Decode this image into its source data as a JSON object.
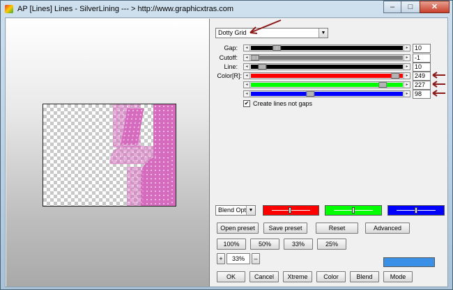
{
  "window": {
    "title": "AP [Lines]  Lines - SilverLining    --- > http://www.graphicxtras.com",
    "minimize": "–",
    "maximize": "□",
    "close": "✕"
  },
  "preset_combo": {
    "value": "Dotty Grid"
  },
  "params": [
    {
      "label": "Gap:",
      "value": "10",
      "fill_fraction": 0.15,
      "color": "#000000"
    },
    {
      "label": "Cutoff:",
      "value": "-1",
      "fill_fraction": 0.0,
      "color": "#7a7a7a"
    },
    {
      "label": "Line:",
      "value": "10",
      "fill_fraction": 0.05,
      "color": "#000000"
    }
  ],
  "color_label": "Color[R]:",
  "color_channels": [
    {
      "name": "red",
      "value": "249",
      "fraction": 0.976,
      "color": "#ff0000"
    },
    {
      "name": "green",
      "value": "227",
      "fraction": 0.89,
      "color": "#00ff00"
    },
    {
      "name": "blue",
      "value": "98",
      "fraction": 0.384,
      "color": "#0000ff"
    }
  ],
  "checkbox": {
    "label": "Create lines not gaps",
    "checked": true,
    "mark": "✔"
  },
  "blend_combo": {
    "value": "Blend Optio"
  },
  "swatches": [
    "#ff0000",
    "#00ff00",
    "#0000ff"
  ],
  "buttons": {
    "open_preset": "Open preset",
    "save_preset": "Save preset",
    "reset": "Reset",
    "advanced": "Advanced",
    "zoom100": "100%",
    "zoom50": "50%",
    "zoom33": "33%",
    "zoom25": "25%",
    "zoom_plus": "+",
    "zoom_minus": "–",
    "zoom_value": "33%",
    "ok": "OK",
    "cancel": "Cancel",
    "xtreme": "Xtreme",
    "color": "Color",
    "blend": "Blend",
    "mode": "Mode"
  },
  "color_preview": "#3a8fe6",
  "accent": "#8b1a1a"
}
